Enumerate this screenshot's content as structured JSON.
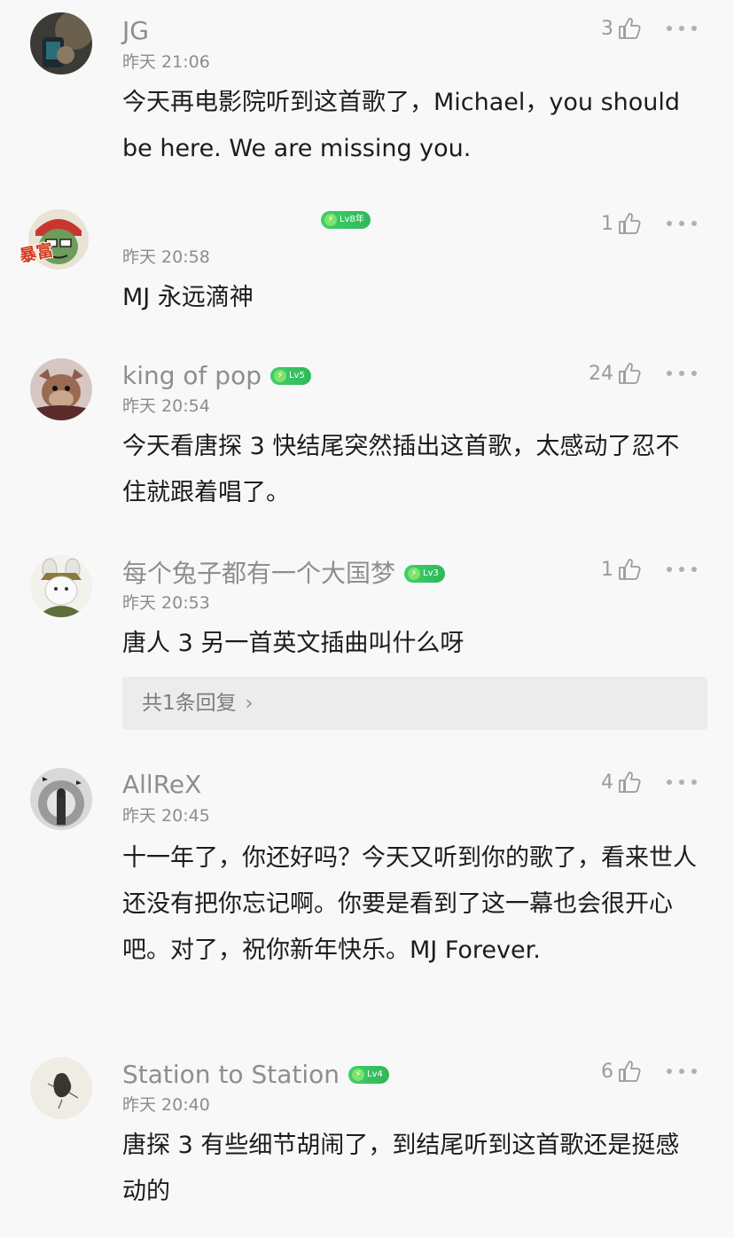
{
  "comments": [
    {
      "username": "JG",
      "level": "",
      "time": "昨天 21:06",
      "likes": "3",
      "text": "今天再电影院听到这首歌了，Michael，you should be here. We are missing you."
    },
    {
      "username": "",
      "level": "Lv8年",
      "time": "昨天 20:58",
      "likes": "1",
      "text": "MJ 永远滴神"
    },
    {
      "username": "king of pop",
      "level": "Lv5",
      "time": "昨天 20:54",
      "likes": "24",
      "text": "今天看唐探 3 快结尾突然插出这首歌，太感动了忍不住就跟着唱了。"
    },
    {
      "username": "每个兔子都有一个大国梦",
      "level": "Lv3",
      "time": "昨天 20:53",
      "likes": "1",
      "text": "唐人 3 另一首英文插曲叫什么呀",
      "reply": "共1条回复"
    },
    {
      "username": "AllReX",
      "level": "",
      "time": "昨天 20:45",
      "likes": "4",
      "text": "十一年了，你还好吗？今天又听到你的歌了，看来世人还没有把你忘记啊。你要是看到了这一幕也会很开心吧。对了，祝你新年快乐。MJ Forever."
    },
    {
      "username": "Station to Station",
      "level": "Lv4",
      "time": "昨天 20:40",
      "likes": "6",
      "text": "唐探 3 有些细节胡闹了，到结尾听到这首歌还是挺感动的"
    }
  ],
  "avatar_badge": "暴富",
  "icons": {
    "like": "thumbs-up-icon",
    "more": "more-dots-icon",
    "level": "lightning-bolt-icon",
    "reply_chevron": "chevron-right-icon"
  },
  "colors": {
    "background": "#f8f8f8",
    "username": "#8e8e8e",
    "level_badge": "#2fb85a",
    "reply_box": "#ececec"
  }
}
